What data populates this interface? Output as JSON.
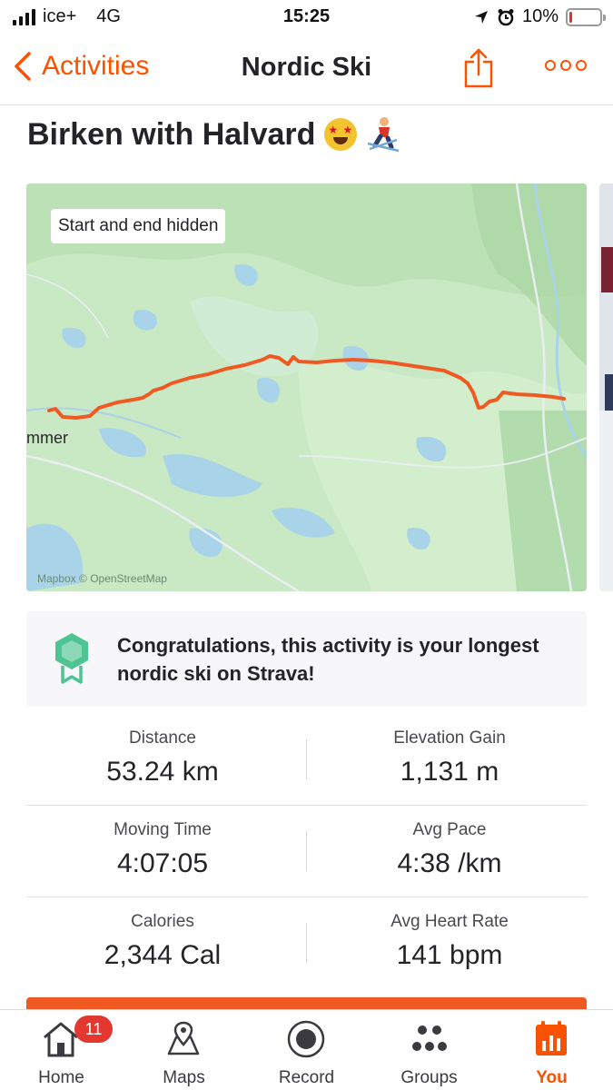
{
  "status_bar": {
    "carrier": "ice+",
    "network": "4G",
    "time": "15:25",
    "battery": "10%",
    "battery_level": 0.1,
    "icons": [
      "signal-icon",
      "location-arrow-icon",
      "alarm-clock-icon",
      "battery-icon"
    ]
  },
  "nav": {
    "back_label": "Activities",
    "title": "Nordic Ski",
    "icons": [
      "chevron-left-icon",
      "share-icon",
      "more-icon"
    ]
  },
  "activity": {
    "title": "Birken with Halvard",
    "emojis": [
      "star-struck-emoji",
      "skier-emoji"
    ]
  },
  "map": {
    "badge": "Start and end hidden",
    "place_label": "mmer",
    "attribution": "Mapbox © OpenStreetMap",
    "route_color": "#f05a22"
  },
  "achievement": {
    "text": "Congratulations, this activity is your longest nordic ski on Strava!",
    "icon": "achievement-badge-icon",
    "icon_color": "#4fc493"
  },
  "stats": [
    {
      "left": {
        "label": "Distance",
        "value": "53.24 km"
      },
      "right": {
        "label": "Elevation Gain",
        "value": "1,131 m"
      }
    },
    {
      "left": {
        "label": "Moving Time",
        "value": "4:07:05"
      },
      "right": {
        "label": "Avg Pace",
        "value": "4:38 /km"
      }
    },
    {
      "left": {
        "label": "Calories",
        "value": "2,344 Cal"
      },
      "right": {
        "label": "Avg Heart Rate",
        "value": "141 bpm"
      }
    }
  ],
  "tabbar": {
    "home": {
      "label": "Home",
      "badge": "11",
      "icon": "home-icon"
    },
    "maps": {
      "label": "Maps",
      "icon": "maps-icon"
    },
    "record": {
      "label": "Record",
      "icon": "record-icon"
    },
    "groups": {
      "label": "Groups",
      "icon": "groups-icon"
    },
    "you": {
      "label": "You",
      "icon": "you-icon",
      "active": true
    }
  },
  "colors": {
    "accent": "#fc5200",
    "text": "#242428",
    "map_land": "#c9e8c4",
    "map_water": "#a9d3e8",
    "badge_red": "#e2382f"
  }
}
